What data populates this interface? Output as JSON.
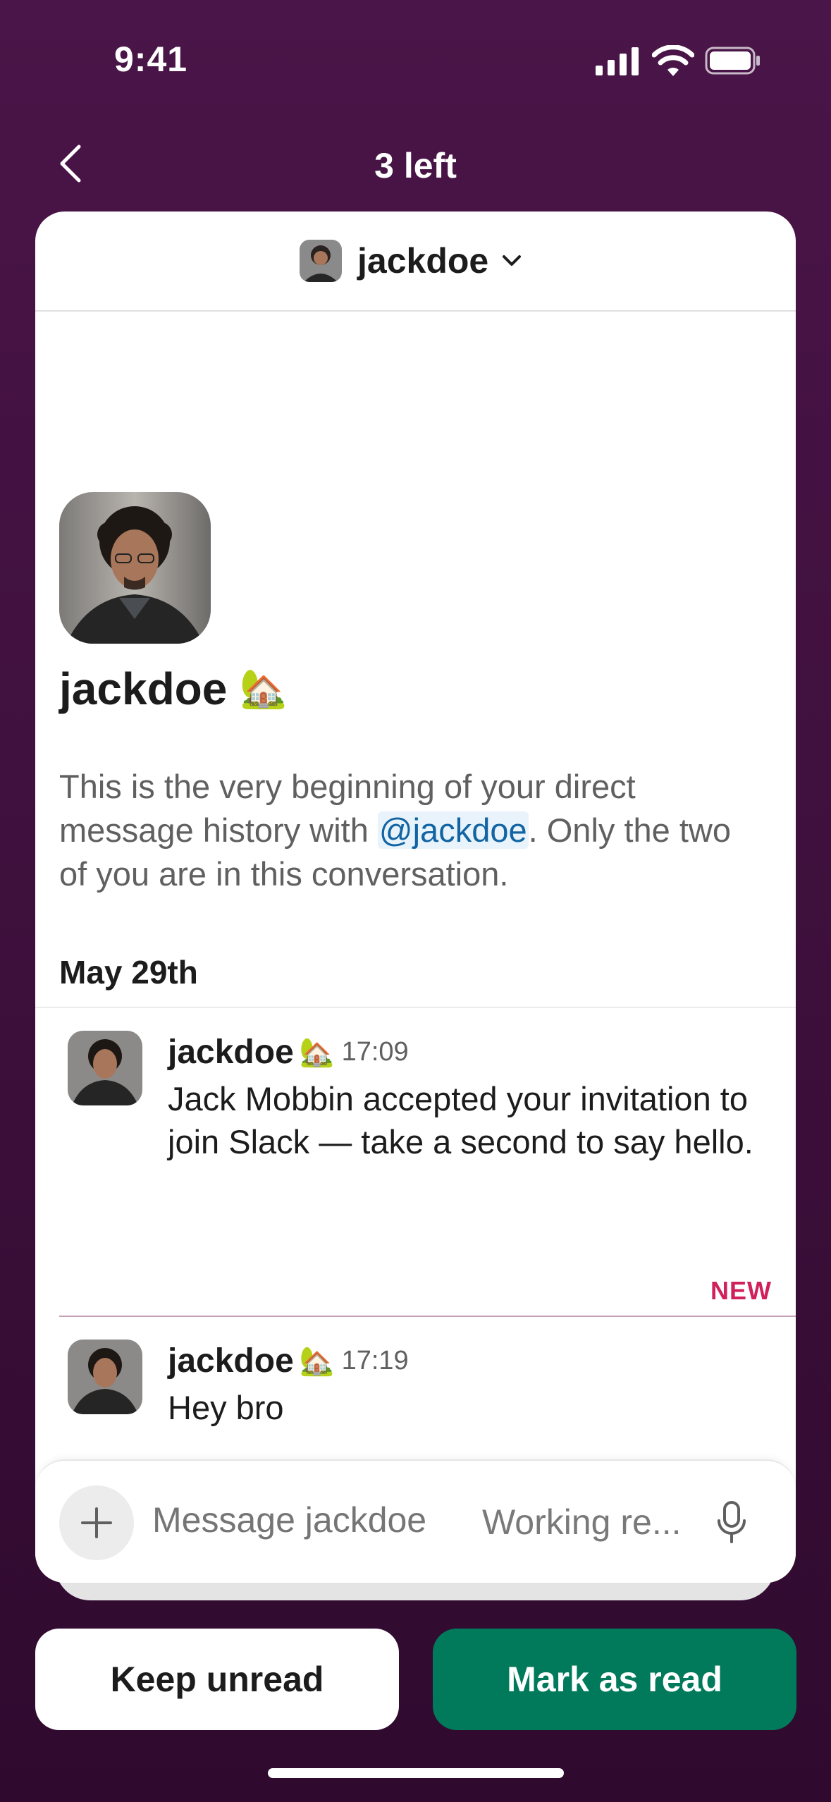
{
  "status_bar": {
    "time": "9:41"
  },
  "header": {
    "title": "3 left"
  },
  "dm": {
    "username": "jackdoe",
    "status_emoji": "🏡",
    "intro": {
      "part1": "This is the very beginning of your direct message history with ",
      "mention": "@jackdoe",
      "part2": ". Only the two of you are in this conversation."
    }
  },
  "messages": {
    "date_label": "May 29th",
    "new_label": "NEW",
    "items": [
      {
        "author": "jackdoe",
        "emoji": "🏡",
        "time": "17:09",
        "text": "Jack Mobbin accepted your invitation to join Slack — take a second to say hello."
      },
      {
        "author": "jackdoe",
        "emoji": "🏡",
        "time": "17:19",
        "text": "Hey bro"
      }
    ]
  },
  "composer": {
    "placeholder": "Message jackdoe",
    "status_text": "Working re..."
  },
  "actions": {
    "keep_unread": "Keep unread",
    "mark_read": "Mark as read"
  }
}
